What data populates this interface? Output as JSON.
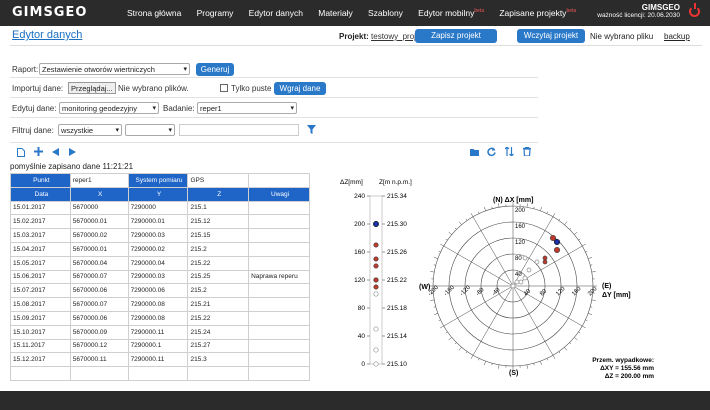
{
  "app": {
    "logo": "GIMSGEO",
    "nav": [
      {
        "label": "Strona główna",
        "beta": ""
      },
      {
        "label": "Programy",
        "beta": ""
      },
      {
        "label": "Edytor danych",
        "beta": ""
      },
      {
        "label": "Materiały",
        "beta": ""
      },
      {
        "label": "Szablony",
        "beta": ""
      },
      {
        "label": "Edytor mobilny",
        "beta": "beta"
      },
      {
        "label": "Zapisane projekty",
        "beta": "beta"
      }
    ],
    "user": "GIMSGEO",
    "license": "ważność licencji: 20.06.2030"
  },
  "header": {
    "title": "Edytor danych",
    "project_label": "Projekt:",
    "project_name": "testowy_projekt",
    "save_btn": "Zapisz projekt",
    "load_btn": "Wczytaj projekt",
    "no_file": "Nie wybrano pliku",
    "backup": "backup"
  },
  "form": {
    "report_label": "Raport:",
    "report_value": "Zestawienie otworów wiertniczych",
    "generate_btn": "Generuj",
    "import_label": "Importuj dane:",
    "browse_btn": "Przeglądaj...",
    "no_files": "Nie wybrano plików.",
    "only_empty": "Tylko puste",
    "load_data_btn": "Wgraj dane",
    "edit_label": "Edytuj dane:",
    "edit_value": "monitoring geodezyjny",
    "study_label": "Badanie:",
    "study_value": "reper1",
    "filter_label": "Filtruj dane:",
    "filter_value": "wszystkie",
    "filter_value2": ""
  },
  "status": "pomyślnie zapisano dane 11:21:21",
  "table": {
    "meta": [
      "Punkt",
      "reper1",
      "System pomiaru",
      "GPS"
    ],
    "headers": [
      "Data",
      "X",
      "Y",
      "Z",
      "Uwagi"
    ],
    "rows": [
      [
        "15.01.2017",
        "5670000",
        "7290000",
        "215.1",
        ""
      ],
      [
        "15.02.2017",
        "5670000.01",
        "7290000.01",
        "215.12",
        ""
      ],
      [
        "15.03.2017",
        "5670000.02",
        "7290000.03",
        "215.15",
        ""
      ],
      [
        "15.04.2017",
        "5670000.01",
        "7290000.02",
        "215.2",
        ""
      ],
      [
        "15.05.2017",
        "5670000.04",
        "7290000.04",
        "215.22",
        ""
      ],
      [
        "15.06.2017",
        "5670000.07",
        "7290000.03",
        "215.25",
        "Naprawa reperu"
      ],
      [
        "15.07.2017",
        "5670000.06",
        "7290000.06",
        "215.2",
        ""
      ],
      [
        "15.08.2017",
        "5670000.07",
        "7290000.08",
        "215.21",
        ""
      ],
      [
        "15.09.2017",
        "5670000.06",
        "7290000.08",
        "215.22",
        ""
      ],
      [
        "15.10.2017",
        "5670000.09",
        "7290000.11",
        "215.24",
        ""
      ],
      [
        "15.11.2017",
        "5670000.12",
        "7290000.1",
        "215.27",
        ""
      ],
      [
        "15.12.2017",
        "5670000.11",
        "7290000.11",
        "215.3",
        ""
      ],
      [
        "",
        "",
        "",
        "",
        ""
      ]
    ]
  },
  "chart_data": [
    {
      "type": "scatter",
      "title": "",
      "ylabel": "ΔZ[mm]",
      "y2label": "Z[m n.p.m.]",
      "ylim": [
        0,
        240
      ],
      "y2lim": [
        215.1,
        215.34
      ],
      "yticks": [
        "0",
        "40",
        "80",
        "120",
        "160",
        "200",
        "240"
      ],
      "y2ticks": [
        "215.10",
        "215.14",
        "215.18",
        "215.22",
        "215.26",
        "215.30",
        "215.34"
      ],
      "values": [
        0,
        20,
        50,
        100,
        120,
        150,
        100,
        110,
        120,
        140,
        170,
        200
      ],
      "highlight": {
        "last": "#1a2fa8",
        "red_from_index": 9,
        "red": "#c0392b",
        "normal": "#999999"
      }
    },
    {
      "type": "scatter",
      "subtype": "polar",
      "top_label": "(N) ΔX [mm]",
      "bottom_label": "(S)",
      "left_label": "(W)",
      "right_label": "(E)\nΔY [mm]",
      "rlim": [
        0,
        200
      ],
      "rticks": [
        "40",
        "80",
        "120",
        "160",
        "200"
      ],
      "points_dy_dx": [
        [
          0,
          0
        ],
        [
          10,
          10
        ],
        [
          30,
          20
        ],
        [
          20,
          10
        ],
        [
          40,
          40
        ],
        [
          30,
          70
        ],
        [
          60,
          60
        ],
        [
          80,
          70
        ],
        [
          80,
          60
        ],
        [
          110,
          90
        ],
        [
          100,
          120
        ],
        [
          110,
          110
        ]
      ],
      "summary_title": "Przem. wypadkowe:",
      "summary_dxy": "ΔXY = 155.56 mm",
      "summary_dz": "ΔZ = 200.00 mm"
    }
  ]
}
